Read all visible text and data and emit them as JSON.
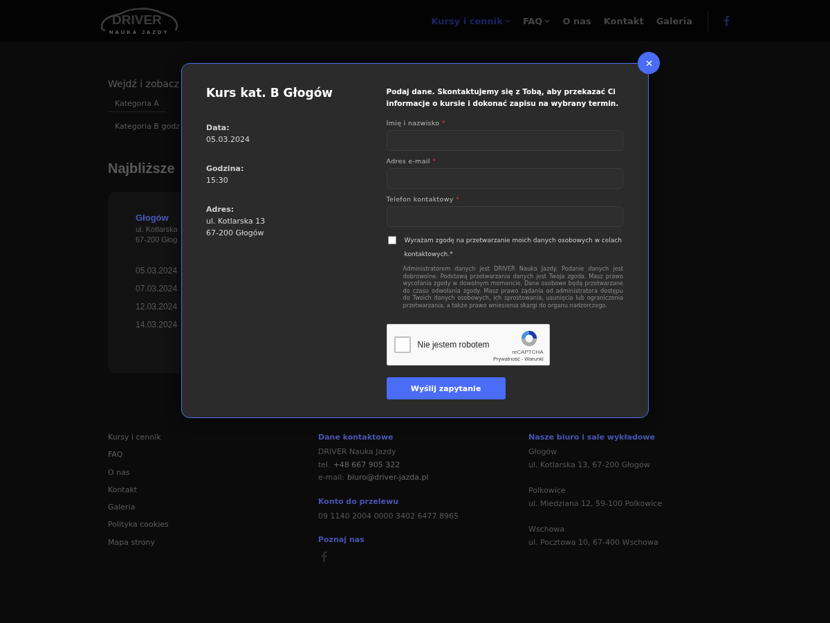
{
  "header": {
    "logo": {
      "title": "DRIVER",
      "subtitle": "NAUKA JAZDY"
    },
    "nav": [
      {
        "label": "Kursy i cennik",
        "selected": true,
        "has_dropdown": true
      },
      {
        "label": "FAQ",
        "selected": false,
        "has_dropdown": true
      },
      {
        "label": "O nas",
        "selected": false,
        "has_dropdown": false
      },
      {
        "label": "Kontakt",
        "selected": false,
        "has_dropdown": false
      },
      {
        "label": "Galeria",
        "selected": false,
        "has_dropdown": false
      }
    ]
  },
  "background": {
    "intro": "Wejdź i zobacz",
    "category_tabs": [
      {
        "label": "Kategoria A",
        "selected": true
      },
      {
        "label": "Kategoria B godz",
        "selected": false
      }
    ],
    "section_title": "Najbliższe",
    "card": {
      "city": "Głogów",
      "street": "ul. Kotlarska",
      "postal": "67-200 Głog",
      "dates": [
        "05.03.2024",
        "07.03.2024",
        "12.03.2024",
        "14.03.2024"
      ]
    }
  },
  "modal": {
    "title": "Kurs kat. B Głogów",
    "details": [
      {
        "label": "Data:",
        "lines": [
          "05.03.2024"
        ]
      },
      {
        "label": "Godzina:",
        "lines": [
          "15:30"
        ]
      },
      {
        "label": "Adres:",
        "lines": [
          "ul. Kotlarska 13",
          "67-200 Głogów"
        ]
      }
    ],
    "form": {
      "intro": "Podaj dane. Skontaktujemy się z Tobą, aby przekazać Ci informacje o kursie i dokonać zapisu na wybrany termin.",
      "fields": [
        {
          "label": "Imię i nazwisko",
          "required_mark": "*"
        },
        {
          "label": "Adres e-mail",
          "required_mark": "*"
        },
        {
          "label": "Telefon kontaktowy",
          "required_mark": "*"
        }
      ],
      "consent": {
        "checked": false,
        "label": "Wyrażam zgodę na przetwarzanie moich danych osobowych w celach kontaktowych.*",
        "note": "Administratorem danych jest DRIVER Nauka Jazdy. Podanie danych jest dobrowolne. Podstawą przetwarzania danych jest Twoja zgoda. Masz prawo wycofania zgody w dowolnym momencie. Dane osobowe będą przetwarzane do czasu odwołania zgody. Masz prawo żądania od administratora dostępu do Twoich danych osobowych, ich sprostowania, usunięcia lub ograniczenia przetwarzania, a także prawo wniesienia skargi do organu nadzorczego."
      },
      "captcha": {
        "checked": false,
        "label": "Nie jestem robotem",
        "brand": "reCAPTCHA",
        "links": [
          "Prywatność",
          "Warunki"
        ],
        "separator": "-"
      },
      "submit": "Wyślij zapytanie"
    }
  },
  "footer": {
    "links": [
      "Kursy i cennik",
      "FAQ",
      "O nas",
      "Kontakt",
      "Galeria",
      "Polityka cookies",
      "Mapa strony"
    ],
    "contact": {
      "heading": "Dane kontaktowe",
      "name": "DRIVER Nauka Jazdy",
      "phone": {
        "prefix": "tel.",
        "value": "+48 667 905 322"
      },
      "email": {
        "prefix": "e-mail:",
        "value": "biuro@driver-jazda.pl"
      }
    },
    "bank": {
      "heading": "Konto do przelewu",
      "account": "09 1140 2004 0000 3402 6477 8965"
    },
    "social": {
      "heading": "Poznaj nas"
    },
    "offices": {
      "heading": "Nasze biuro i sale wykładowe",
      "items": [
        {
          "city": "Głogów",
          "address": "ul. Kotlarska 13, 67-200 Głogów"
        },
        {
          "city": "Polkowice",
          "address": "ul. Miedziana 12, 59-100 Polkowice"
        },
        {
          "city": "Wschowa",
          "address": "ul. Pocztowa 10, 67-400 Wschowa"
        }
      ]
    }
  }
}
